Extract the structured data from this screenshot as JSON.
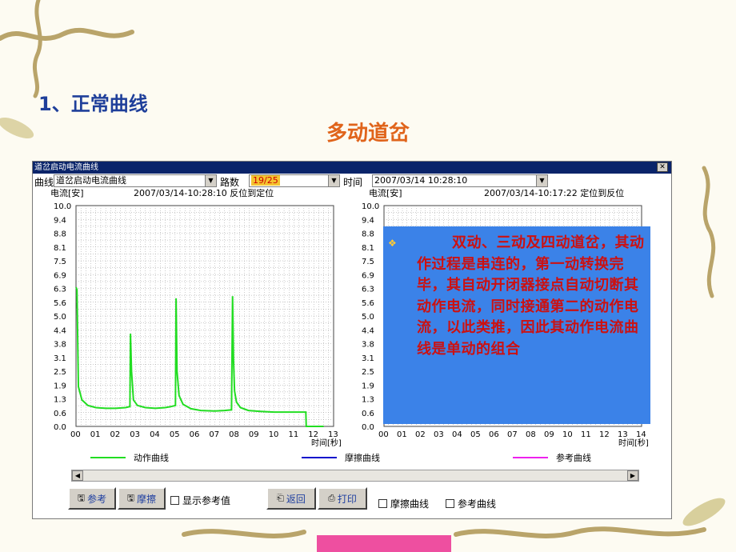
{
  "slide": {
    "heading": "1、正常曲线",
    "title": "多动道岔"
  },
  "window": {
    "title": "道岔启动电流曲线",
    "close_icon": "✕",
    "toolbar": {
      "curve_label": "曲线",
      "curve_value": "道岔启动电流曲线",
      "route_label": "路数",
      "route_value": "19/25",
      "time_label": "时间",
      "time_value": "2007/03/14 10:28:10"
    },
    "left_plot": {
      "unit_label": "电流[安]",
      "info": "2007/03/14-10:28:10 反位到定位",
      "x_axis_label": "时间[秒]"
    },
    "right_plot": {
      "unit_label": "电流[安]",
      "info": "2007/03/14-10:17:22 定位到反位",
      "x_axis_label": "时间[秒]"
    },
    "overlay_text": "双动、三动及四动道岔，其动作过程是串连的，第一动转换完毕，其自动开闭器接点自动切断其动作电流，同时接通第二的动作电流，以此类推，因此其动作电流曲线是单动的组合",
    "legend": [
      {
        "label": "动作曲线",
        "color": "#22dd22"
      },
      {
        "label": "摩擦曲线",
        "color": "#1010cc"
      },
      {
        "label": "参考曲线",
        "color": "#ee22ee"
      }
    ],
    "buttons": {
      "ref": "参考",
      "friction": "摩擦",
      "show_ref": "显示参考值",
      "back": "返回",
      "print": "打印",
      "friction_curve": "摩擦曲线",
      "ref_curve": "参考曲线"
    }
  },
  "chart_data": [
    {
      "type": "line",
      "title": "2007/03/14-10:28:10 反位到定位",
      "ylabel": "电流[安]",
      "xlabel": "时间[秒]",
      "yticks": [
        "10.0",
        "9.4",
        "8.8",
        "8.1",
        "7.5",
        "6.9",
        "6.3",
        "5.6",
        "5.0",
        "4.4",
        "3.8",
        "3.1",
        "2.5",
        "1.9",
        "1.3",
        "0.6",
        "0.0"
      ],
      "xticks": [
        "00",
        "01",
        "02",
        "03",
        "04",
        "05",
        "06",
        "07",
        "08",
        "09",
        "10",
        "11",
        "12",
        "13"
      ],
      "ylim": [
        0,
        10
      ],
      "xlim": [
        0,
        13
      ],
      "series": [
        {
          "name": "动作曲线",
          "color": "#22dd22",
          "x": [
            0,
            0.05,
            0.12,
            0.3,
            0.6,
            1.0,
            1.5,
            2.0,
            2.5,
            2.72,
            2.75,
            2.8,
            2.9,
            3.1,
            3.5,
            4.0,
            4.5,
            4.8,
            5.02,
            5.05,
            5.1,
            5.2,
            5.4,
            5.8,
            6.3,
            7.0,
            7.5,
            7.85,
            7.9,
            7.95,
            8.0,
            8.1,
            8.3,
            8.7,
            9.3,
            10.0,
            10.5,
            11.0,
            11.6,
            11.62,
            12.0,
            12.5
          ],
          "y": [
            6.3,
            6.2,
            1.8,
            1.2,
            0.95,
            0.85,
            0.82,
            0.82,
            0.85,
            0.9,
            4.2,
            2.5,
            1.2,
            0.95,
            0.85,
            0.82,
            0.85,
            0.9,
            0.95,
            5.8,
            2.5,
            1.4,
            1.0,
            0.8,
            0.72,
            0.7,
            0.72,
            0.75,
            5.9,
            3.0,
            1.6,
            1.1,
            0.85,
            0.72,
            0.68,
            0.65,
            0.65,
            0.65,
            0.65,
            0.0,
            0.0,
            0.0
          ]
        }
      ]
    },
    {
      "type": "line",
      "title": "2007/03/14-10:17:22 定位到反位",
      "ylabel": "电流[安]",
      "xlabel": "时间[秒]",
      "yticks": [
        "10.0",
        "9.4",
        "8.8",
        "8.1",
        "7.5",
        "6.9",
        "6.3",
        "5.6",
        "5.0",
        "4.4",
        "3.8",
        "3.1",
        "2.5",
        "1.9",
        "1.3",
        "0.6",
        "0.0"
      ],
      "xticks": [
        "00",
        "01",
        "02",
        "03",
        "04",
        "05",
        "06",
        "07",
        "08",
        "09",
        "10",
        "11",
        "12",
        "13",
        "14"
      ],
      "ylim": [
        0,
        10
      ],
      "xlim": [
        0,
        14
      ],
      "series": []
    }
  ]
}
